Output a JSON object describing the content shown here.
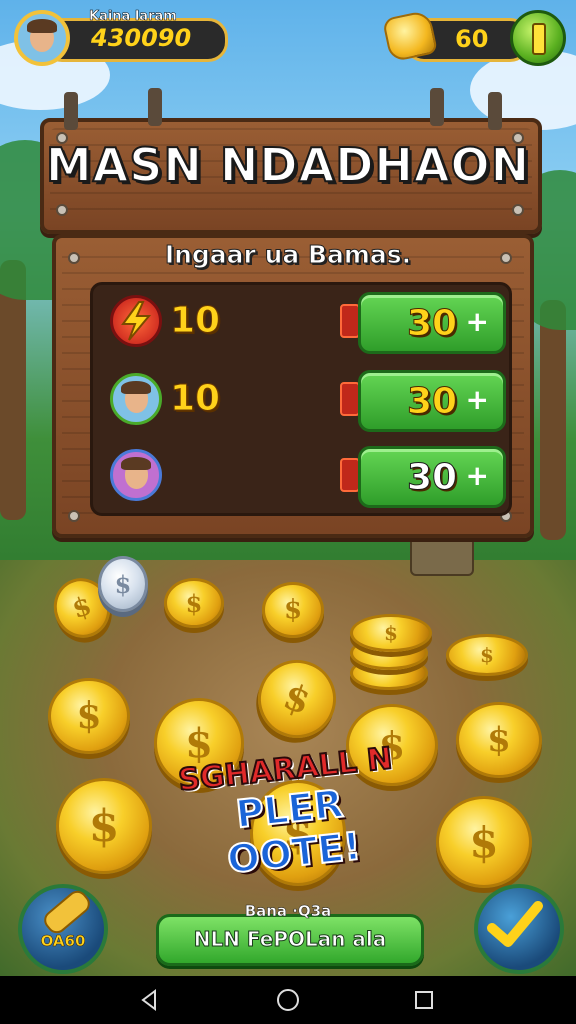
{
  "top_bar": {
    "player_label": "Kaina laram",
    "player_score": "430090",
    "gem_count": "60"
  },
  "board": {
    "title": "MASN  NDADHAON",
    "subtitle": "Ingaar ua Bamas."
  },
  "offers": [
    {
      "amount": "10",
      "price": "30",
      "plus": "+"
    },
    {
      "amount": "10",
      "price": "30",
      "plus": "+"
    },
    {
      "amount": "",
      "price": "30",
      "plus": "+"
    }
  ],
  "promo": {
    "line1": "SGHARALL N",
    "line2": "PLER OOTE!"
  },
  "bottom": {
    "left_button_label": "OA60",
    "cta_caption": "Bana ·Q3a",
    "cta_label": "NLN FePOLan ala"
  },
  "coin_symbol": "$",
  "colors": {
    "wood": "#8a5030",
    "button_green": "#3fb836",
    "coin_gold": "#f8cf2a"
  },
  "icons": {
    "back": "back-triangle-icon",
    "home": "home-circle-icon",
    "recents": "recents-square-icon"
  }
}
